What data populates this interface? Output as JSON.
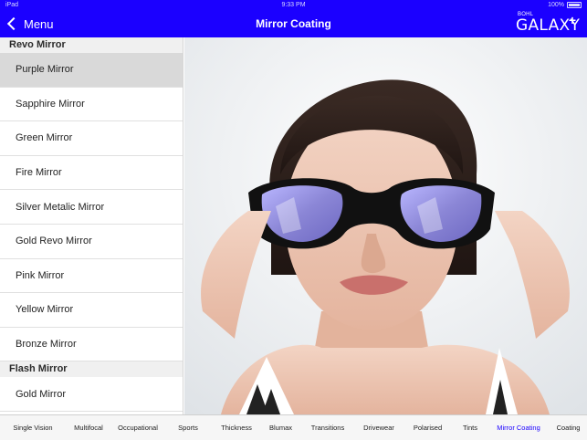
{
  "status_bar": {
    "carrier": "iPad",
    "time": "9:33 PM",
    "battery": "100%"
  },
  "nav": {
    "back_label": "Menu",
    "title": "Mirror Coating",
    "brand_small": "BOHL",
    "brand_main": "GALAXY",
    "brand_plus": "+"
  },
  "sidebar": {
    "sections": [
      {
        "header": "Revo Mirror",
        "items": [
          {
            "label": "Purple Mirror",
            "selected": true
          },
          {
            "label": "Sapphire Mirror"
          },
          {
            "label": "Green Mirror"
          },
          {
            "label": "Fire Mirror"
          },
          {
            "label": "Silver Metalic Mirror"
          },
          {
            "label": "Gold Revo Mirror"
          },
          {
            "label": "Pink Mirror"
          },
          {
            "label": "Yellow Mirror"
          },
          {
            "label": "Bronze Mirror"
          }
        ]
      },
      {
        "header": "Flash Mirror",
        "items": [
          {
            "label": "Gold Mirror"
          }
        ]
      }
    ]
  },
  "hero": {
    "image": "woman-wearing-purple-mirror-sunglasses",
    "lens_color": "#8b86d6"
  },
  "tabbar": {
    "tabs": [
      {
        "label": "Single Vision"
      },
      {
        "label": "Multifocal"
      },
      {
        "label": "Occupational"
      },
      {
        "label": "Sports"
      },
      {
        "label": "Thickness"
      },
      {
        "label": "Blumax"
      },
      {
        "label": "Transitions"
      },
      {
        "label": "Drivewear"
      },
      {
        "label": "Polarised"
      },
      {
        "label": "Tints"
      },
      {
        "label": "Mirror Coating",
        "active": true
      },
      {
        "label": "Coating"
      }
    ]
  },
  "colors": {
    "accent": "#1b00ff",
    "selected_row": "#d9d9d9"
  }
}
